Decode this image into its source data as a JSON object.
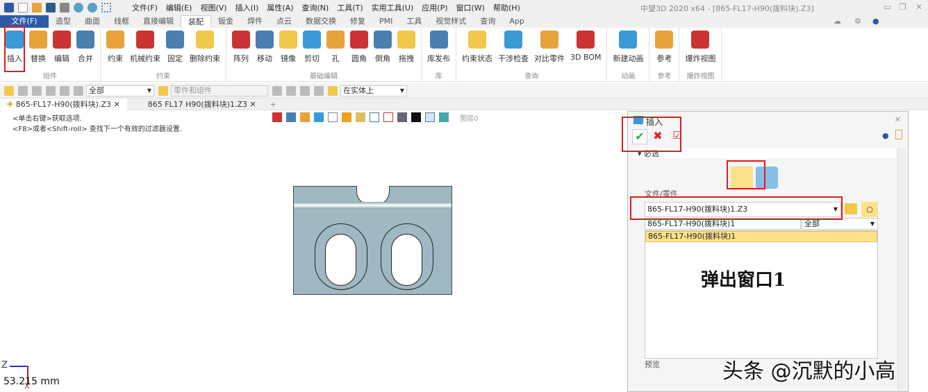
{
  "titlebar": {
    "menus": [
      "文件(F)",
      "编辑(E)",
      "视图(V)",
      "插入(I)",
      "属性(A)",
      "查询(N)",
      "工具(T)",
      "实用工具(U)",
      "应用(P)",
      "窗口(W)",
      "帮助(H)"
    ],
    "title": "中望3D 2020 x64 - [865-FL17-H90(拨料块).Z3]"
  },
  "ribbon_tabs": [
    "文件(F)",
    "造型",
    "曲面",
    "线框",
    "直接编辑",
    "装配",
    "钣金",
    "焊件",
    "点云",
    "数据交换",
    "修复",
    "PMI",
    "工具",
    "视觉样式",
    "查询",
    "App"
  ],
  "ribbon_active": "装配",
  "groups": [
    {
      "label": "组件",
      "buttons": [
        "插入",
        "替换",
        "编辑",
        "合并"
      ]
    },
    {
      "label": "约束",
      "buttons": [
        "约束",
        "机械约束",
        "固定",
        "删除约束"
      ]
    },
    {
      "label": "基础编辑",
      "buttons": [
        "阵列",
        "移动",
        "镜像",
        "剪切",
        "孔",
        "圆角",
        "倒角",
        "拖拽"
      ]
    },
    {
      "label": "库",
      "buttons": [
        "库发布"
      ]
    },
    {
      "label": "查询",
      "buttons": [
        "约束状态",
        "干涉检查",
        "对比零件",
        "3D BOM"
      ]
    },
    {
      "label": "动画",
      "buttons": [
        "新建动画"
      ]
    },
    {
      "label": "参考",
      "buttons": [
        "参考"
      ]
    },
    {
      "label": "爆炸视图",
      "buttons": [
        "爆炸视图"
      ]
    }
  ],
  "toolbar": {
    "filter": "全部",
    "filter2": "零件和组件",
    "pick": "在实体上"
  },
  "doc_tabs": [
    "865-FL17-H90(拨料块).Z3",
    "865 FL17 H90(拨料块)1.Z3"
  ],
  "hints": [
    "<单击右键>获取选项.",
    "<F8>或者<Shift-roll> 查找下一个有效的过滤器设置."
  ],
  "viewport": {
    "layer_label": "图层0",
    "axis_z": "Z",
    "axis_x": "X",
    "measure": "53.215 mm"
  },
  "dialog": {
    "title": "插入",
    "section": "必选",
    "file_label": "文件/零件",
    "file_value": "865-FL17-H90(拨料块)1.Z3",
    "name_value": "865-FL17-H90(拨料块)1",
    "scope": "全部",
    "list": [
      "865-FL17-H90(拨料块)1"
    ],
    "preview_label": "预览",
    "annotation": "弹出窗口1"
  },
  "watermark": "头条 @沉默的小高",
  "colors": {
    "accent": "#2d5aa8",
    "highlight": "#fde28a",
    "annotation_red": "#e21b1b"
  }
}
